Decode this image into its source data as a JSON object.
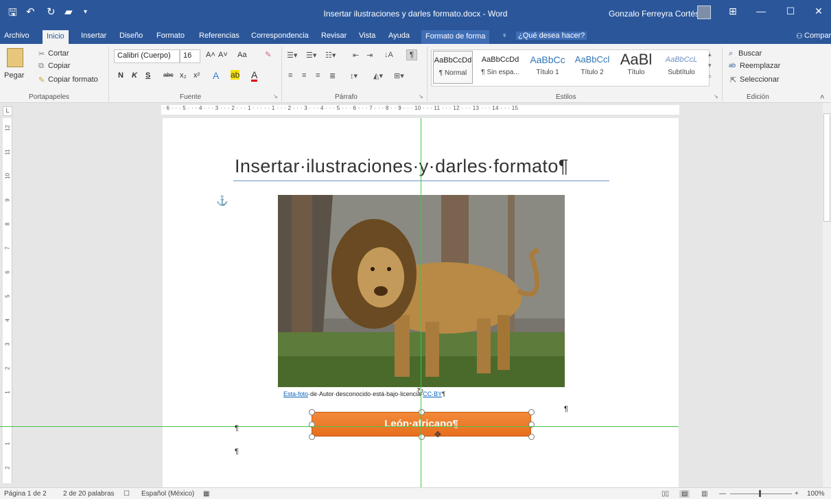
{
  "titlebar": {
    "doc_title": "Insertar ilustraciones y darles formato.docx  -  Word",
    "user_name": "Gonzalo Ferreyra Cortés"
  },
  "tabs": [
    "Archivo",
    "Inicio",
    "Insertar",
    "Diseño",
    "Formato",
    "Referencias",
    "Correspondencia",
    "Revisar",
    "Vista",
    "Ayuda",
    "Formato de forma"
  ],
  "tell_me": "¿Qué desea hacer?",
  "share": "Compartir",
  "clipboard": {
    "paste": "Pegar",
    "cut": "Cortar",
    "copy": "Copiar",
    "format_painter": "Copiar formato",
    "group": "Portapapeles"
  },
  "font": {
    "name": "Calibri (Cuerpo)",
    "size": "16",
    "case": "Aa",
    "bold": "N",
    "italic": "K",
    "underline": "S",
    "strike": "abc",
    "sub": "x₂",
    "sup": "x²",
    "group": "Fuente"
  },
  "paragraph": {
    "group": "Párrafo",
    "pilcrow": "¶"
  },
  "styles": {
    "group": "Estilos",
    "items": [
      {
        "sample": "AaBbCcDd",
        "name": "¶ Normal"
      },
      {
        "sample": "AaBbCcDd",
        "name": "¶ Sin espa..."
      },
      {
        "sample": "AaBbCc",
        "name": "Título 1"
      },
      {
        "sample": "AaBbCcl",
        "name": "Título 2"
      },
      {
        "sample": "AaBl",
        "name": "Título"
      },
      {
        "sample": "AaBbCcL",
        "name": "Subtítulo"
      }
    ]
  },
  "editing": {
    "find": "Buscar",
    "replace": "Reemplazar",
    "select": "Seleccionar",
    "group": "Edición"
  },
  "ruler": {
    "marks": "· 6 · · · 5 · · · 4 · · · 3 · · · 2 · · · 1 · · ·   · · 1 · · · 2 · · · 3 · · · 4 · · · 5 · · · 6 · · · 7 · · · 8 ·   · 9 · · · 10 · · · 11 · · · 12 · · · 13 · · · 14 · · · 15"
  },
  "document": {
    "heading": "Insertar·ilustraciones·y·darles·formato¶",
    "caption_link1": "Esta·foto",
    "caption_mid": "·de·Autor·desconocido·está·bajo·licencia·",
    "caption_link2": "CC·BY",
    "caption_end": "¶",
    "shape_text": "León·africano¶",
    "pilcrow": "¶"
  },
  "status": {
    "page": "Página 1 de 2",
    "words": "2 de 20 palabras",
    "language": "Español (México)",
    "zoom": "100%"
  },
  "colors": {
    "accent": "#2b579a",
    "shape_orange": "#ed7d31",
    "guide": "#41c445"
  }
}
